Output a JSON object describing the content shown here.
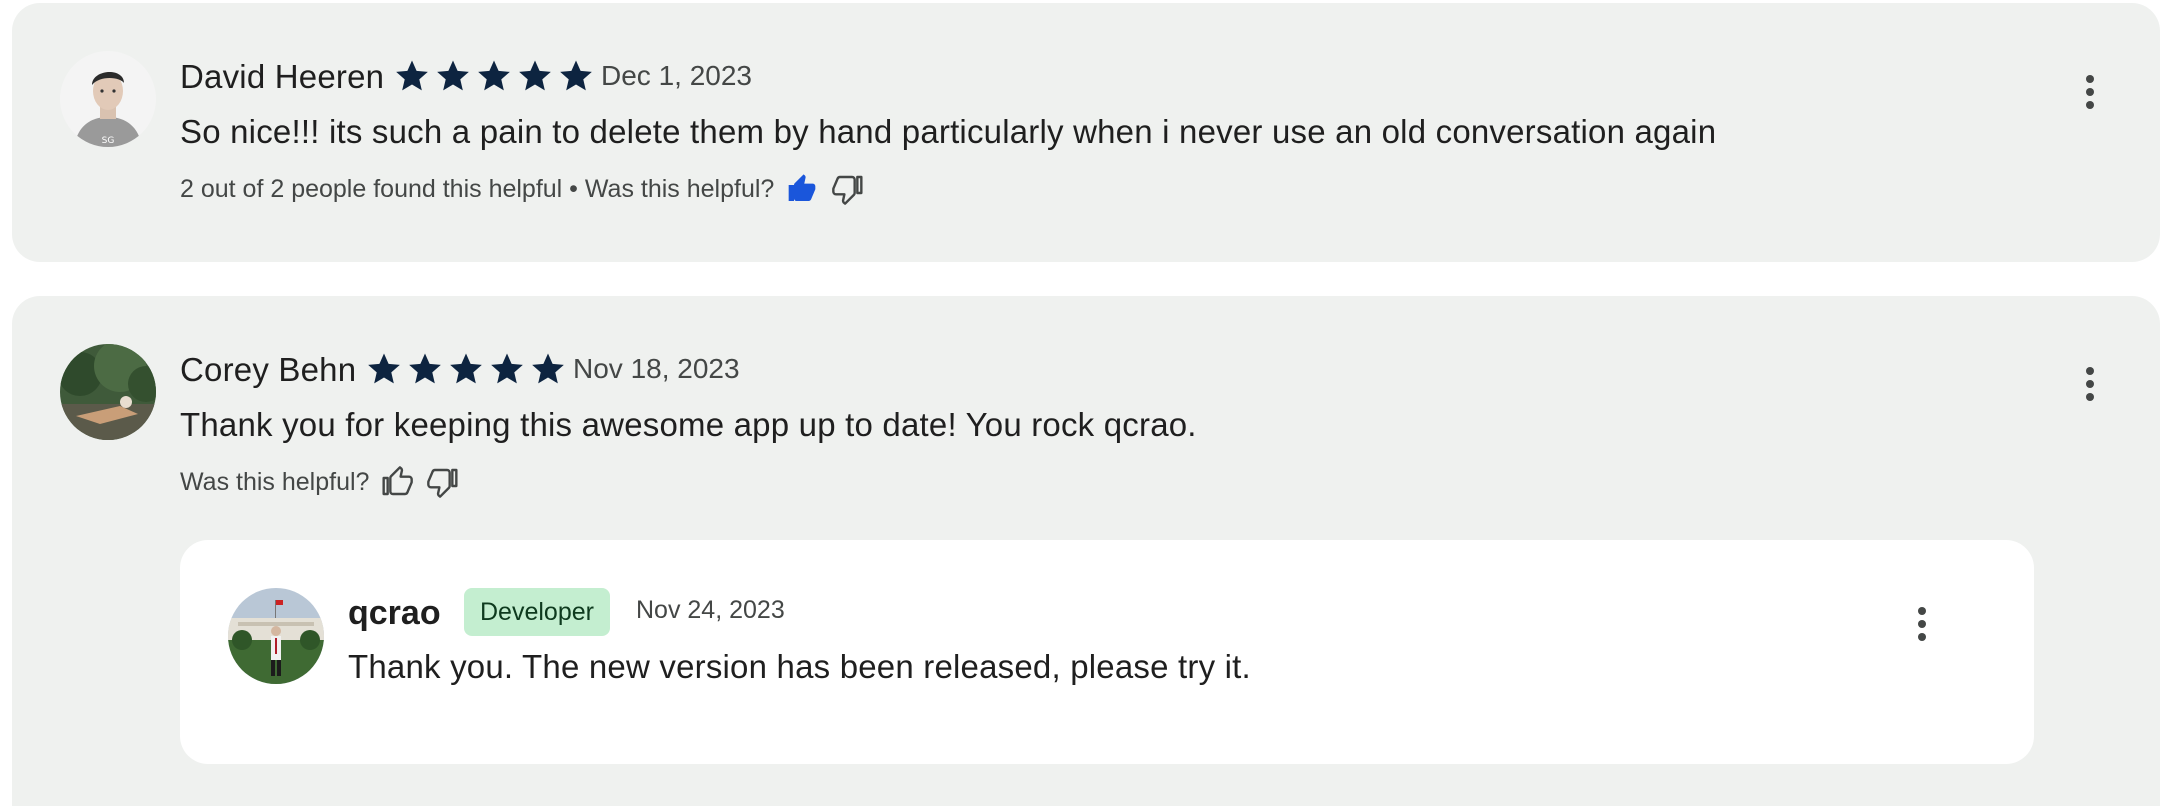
{
  "colors": {
    "card_bg": "#eff1ef",
    "reply_bg": "#ffffff",
    "star": "#0d2440",
    "thumb_active": "#1a56db",
    "badge_bg": "#c4eed0"
  },
  "reviews": [
    {
      "author": "David Heeren",
      "rating": 5,
      "date": "Dec 1, 2023",
      "text": "So nice!!! its such a pain to delete them by hand particularly when i never use an old conversation again",
      "helpful_text": "2 out of 2 people found this helpful • Was this helpful?",
      "thumb_up_selected": true,
      "icons": [
        "avatar",
        "star-icon",
        "thumb-up-icon",
        "thumb-down-icon",
        "more-vert-icon"
      ]
    },
    {
      "author": "Corey Behn",
      "rating": 5,
      "date": "Nov 18, 2023",
      "text": "Thank you for keeping this awesome app up to date! You rock qcrao.",
      "helpful_text": "Was this helpful?",
      "thumb_up_selected": false,
      "reply": {
        "author": "qcrao",
        "badge": "Developer",
        "date": "Nov 24, 2023",
        "text": "Thank you. The new version has been released, please try it."
      }
    }
  ]
}
